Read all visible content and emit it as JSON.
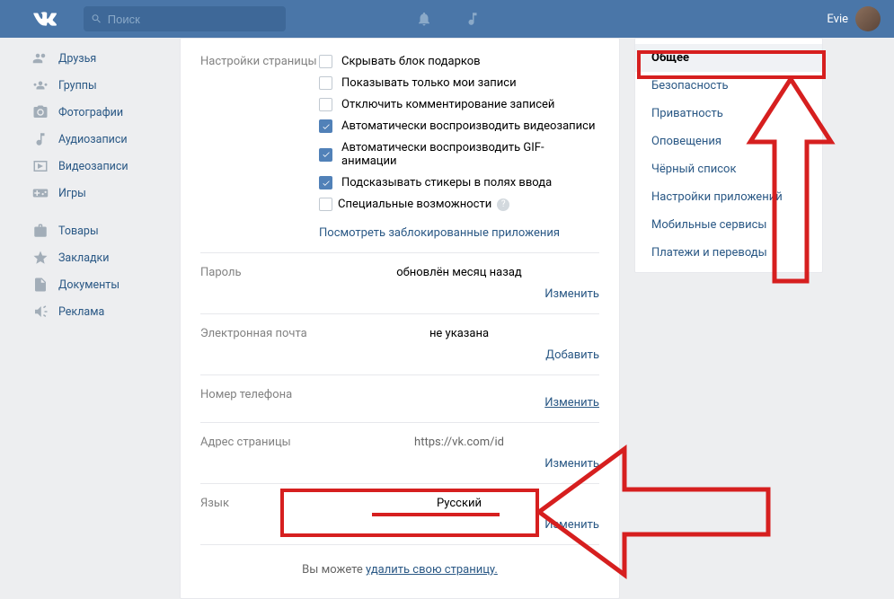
{
  "header": {
    "search_placeholder": "Поиск",
    "username": "Evie"
  },
  "sidebar": {
    "items": [
      {
        "icon": "people",
        "label": "Друзья"
      },
      {
        "icon": "group",
        "label": "Группы"
      },
      {
        "icon": "camera",
        "label": "Фотографии"
      },
      {
        "icon": "music",
        "label": "Аудиозаписи"
      },
      {
        "icon": "video",
        "label": "Видеозаписи"
      },
      {
        "icon": "gamepad",
        "label": "Игры"
      }
    ],
    "items2": [
      {
        "icon": "bag",
        "label": "Товары"
      },
      {
        "icon": "star",
        "label": "Закладки"
      },
      {
        "icon": "doc",
        "label": "Документы"
      },
      {
        "icon": "horn",
        "label": "Реклама"
      }
    ]
  },
  "settings": {
    "section_label": "Настройки страницы",
    "checkboxes": [
      {
        "label": "Скрывать блок подарков",
        "checked": false
      },
      {
        "label": "Показывать только мои записи",
        "checked": false
      },
      {
        "label": "Отключить комментирование записей",
        "checked": false
      },
      {
        "label": "Автоматически воспроизводить видеозаписи",
        "checked": true
      },
      {
        "label": "Автоматически воспроизводить GIF-анимации",
        "checked": true
      },
      {
        "label": "Подсказывать стикеры в полях ввода",
        "checked": true
      }
    ],
    "special_label": "Специальные возможности",
    "blocked_apps_link": "Посмотреть заблокированные приложения",
    "rows": [
      {
        "key": "password",
        "label": "Пароль",
        "value": "обновлён месяц назад",
        "action": "Изменить",
        "underline": false
      },
      {
        "key": "email",
        "label": "Электронная почта",
        "value": "не указана",
        "action": "Добавить",
        "underline": false
      },
      {
        "key": "phone",
        "label": "Номер телефона",
        "value": "",
        "action": "Изменить",
        "underline": true
      },
      {
        "key": "address",
        "label": "Адрес страницы",
        "value": "https://vk.com/id",
        "action": "Изменить",
        "underline": false
      },
      {
        "key": "lang",
        "label": "Язык",
        "value": "Русский",
        "action": "Изменить",
        "underline": false
      }
    ],
    "footer_prefix": "Вы можете ",
    "footer_link": "удалить свою страницу."
  },
  "right_menu": {
    "items": [
      {
        "label": "Общее",
        "active": true
      },
      {
        "label": "Безопасность",
        "active": false
      },
      {
        "label": "Приватность",
        "active": false
      },
      {
        "label": "Оповещения",
        "active": false
      },
      {
        "label": "Чёрный список",
        "active": false
      },
      {
        "label": "Настройки приложений",
        "active": false
      },
      {
        "label": "Мобильные сервисы",
        "active": false
      },
      {
        "label": "Платежи и переводы",
        "active": false
      }
    ]
  }
}
